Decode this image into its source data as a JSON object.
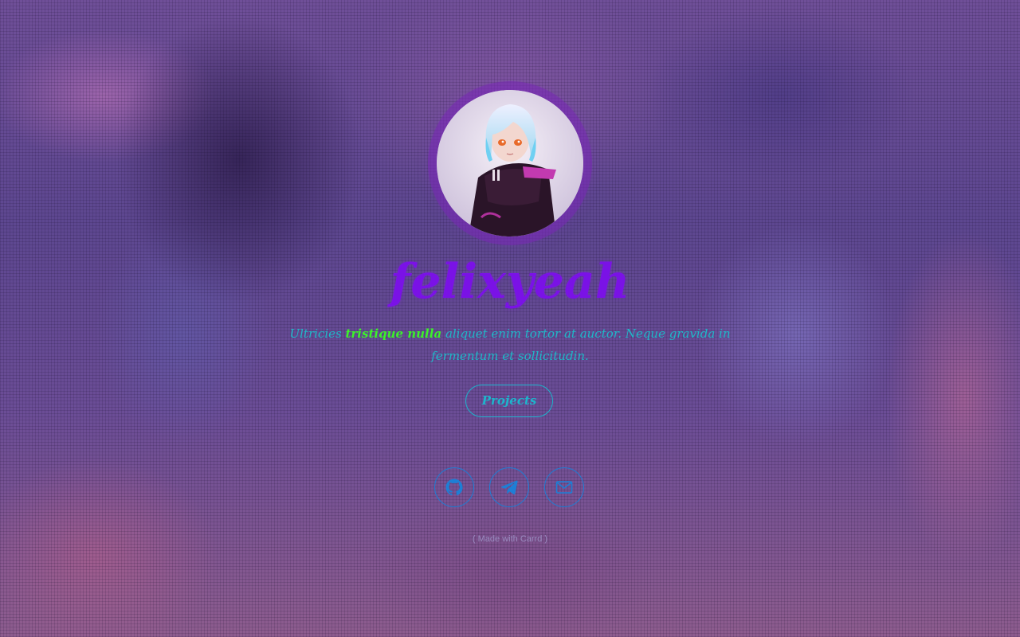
{
  "profile": {
    "title": "felixyeah",
    "description": {
      "before": "Ultricies ",
      "highlight": "tristique nulla",
      "after": " aliquet enim tortor at auctor. Neque gravida in fermentum et sollicitudin."
    }
  },
  "buttons": {
    "projects_label": "Projects"
  },
  "social": [
    {
      "name": "github",
      "icon": "github-icon"
    },
    {
      "name": "telegram",
      "icon": "telegram-icon"
    },
    {
      "name": "email",
      "icon": "envelope-icon"
    }
  ],
  "footer": {
    "credit": "( Made with Carrd )"
  },
  "colors": {
    "title": "#7a12e6",
    "description": "#1fb8c8",
    "highlight": "#3cf22a",
    "button": "#1db5cc",
    "social": "#1d7fd6",
    "avatar_ring": "#7828b4"
  }
}
